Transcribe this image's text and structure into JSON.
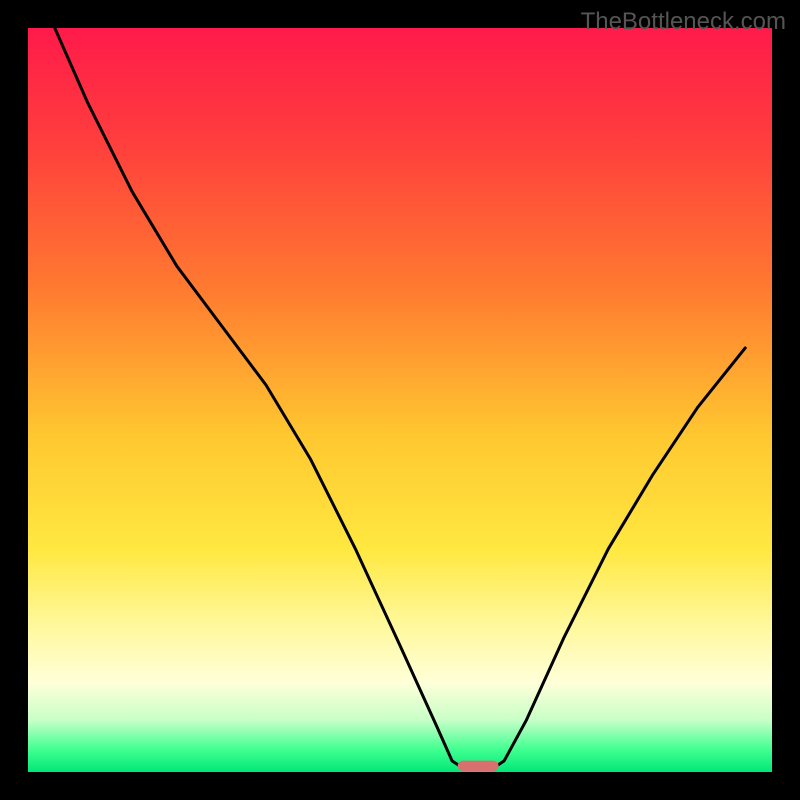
{
  "watermark": "TheBottleneck.com",
  "chart_data": {
    "type": "line",
    "title": "",
    "xlabel": "",
    "ylabel": "",
    "xlim": [
      0,
      100
    ],
    "ylim": [
      0,
      100
    ],
    "background_gradient": {
      "stops": [
        {
          "offset": 0,
          "color": "#ff1a4a"
        },
        {
          "offset": 15,
          "color": "#ff3d3d"
        },
        {
          "offset": 35,
          "color": "#ff7a30"
        },
        {
          "offset": 55,
          "color": "#ffc830"
        },
        {
          "offset": 70,
          "color": "#ffe840"
        },
        {
          "offset": 80,
          "color": "#fff89a"
        },
        {
          "offset": 88,
          "color": "#ffffd8"
        },
        {
          "offset": 93,
          "color": "#c8ffc8"
        },
        {
          "offset": 97,
          "color": "#40ff90"
        },
        {
          "offset": 100,
          "color": "#00e878"
        }
      ]
    },
    "border_color": "#000000",
    "border_width": 28,
    "series": [
      {
        "name": "bottleneck-curve",
        "stroke": "#000000",
        "stroke_width": 3,
        "points": [
          {
            "x": 3.6,
            "y": 100
          },
          {
            "x": 8,
            "y": 90
          },
          {
            "x": 14,
            "y": 78
          },
          {
            "x": 20,
            "y": 68
          },
          {
            "x": 26,
            "y": 60
          },
          {
            "x": 32,
            "y": 52
          },
          {
            "x": 38,
            "y": 42
          },
          {
            "x": 44,
            "y": 30
          },
          {
            "x": 50,
            "y": 17
          },
          {
            "x": 55,
            "y": 6
          },
          {
            "x": 57,
            "y": 1.5
          },
          {
            "x": 58.5,
            "y": 0.5
          },
          {
            "x": 62.5,
            "y": 0.5
          },
          {
            "x": 64,
            "y": 1.5
          },
          {
            "x": 67,
            "y": 7
          },
          {
            "x": 72,
            "y": 18
          },
          {
            "x": 78,
            "y": 30
          },
          {
            "x": 84,
            "y": 40
          },
          {
            "x": 90,
            "y": 49
          },
          {
            "x": 96.4,
            "y": 57
          }
        ]
      }
    ],
    "marker": {
      "name": "optimal-zone-marker",
      "x_center": 60.5,
      "width": 5.5,
      "height": 1.4,
      "fill": "#d87070",
      "rx": 0.7
    }
  }
}
